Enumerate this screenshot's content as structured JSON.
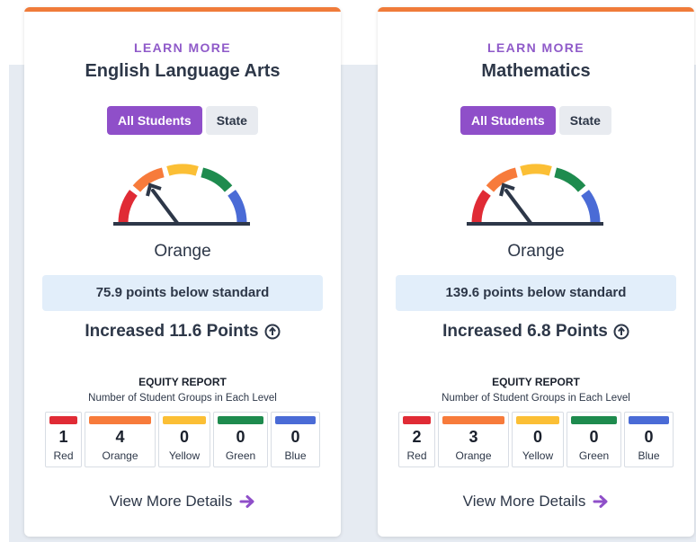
{
  "cards": [
    {
      "learn_more": "LEARN MORE",
      "subject": "English Language Arts",
      "toggle_all": "All Students",
      "toggle_state": "State",
      "performance_color": "Orange",
      "distance_from_standard": "75.9 points below standard",
      "change_text": "Increased 11.6 Points",
      "equity_title": "EQUITY REPORT",
      "equity_subtitle": "Number of Student Groups in Each Level",
      "levels": [
        {
          "count": "1",
          "label": "Red",
          "color": "#e02b35"
        },
        {
          "count": "4",
          "label": "Orange",
          "color": "#f77b3b"
        },
        {
          "count": "0",
          "label": "Yellow",
          "color": "#fbbf35"
        },
        {
          "count": "0",
          "label": "Green",
          "color": "#1e8b4e"
        },
        {
          "count": "0",
          "label": "Blue",
          "color": "#4a6bd6"
        }
      ],
      "view_more": "View More Details"
    },
    {
      "learn_more": "LEARN MORE",
      "subject": "Mathematics",
      "toggle_all": "All Students",
      "toggle_state": "State",
      "performance_color": "Orange",
      "distance_from_standard": "139.6 points below standard",
      "change_text": "Increased 6.8 Points",
      "equity_title": "EQUITY REPORT",
      "equity_subtitle": "Number of Student Groups in Each Level",
      "levels": [
        {
          "count": "2",
          "label": "Red",
          "color": "#e02b35"
        },
        {
          "count": "3",
          "label": "Orange",
          "color": "#f77b3b"
        },
        {
          "count": "0",
          "label": "Yellow",
          "color": "#fbbf35"
        },
        {
          "count": "0",
          "label": "Green",
          "color": "#1e8b4e"
        },
        {
          "count": "0",
          "label": "Blue",
          "color": "#4a6bd6"
        }
      ],
      "view_more": "View More Details"
    }
  ],
  "colors": {
    "accent_bar": "#f07b3a",
    "learn_more": "#8f5ac9",
    "toggle_active": "#8f4fc9",
    "standard_box": "#e2eefa",
    "arrow": "#8f4fc9",
    "gauge_needle": "#2d3748"
  },
  "icons": {
    "change": "circle-up-arrow-icon",
    "view_more": "arrow-right-icon",
    "gauge": "performance-gauge-icon"
  }
}
